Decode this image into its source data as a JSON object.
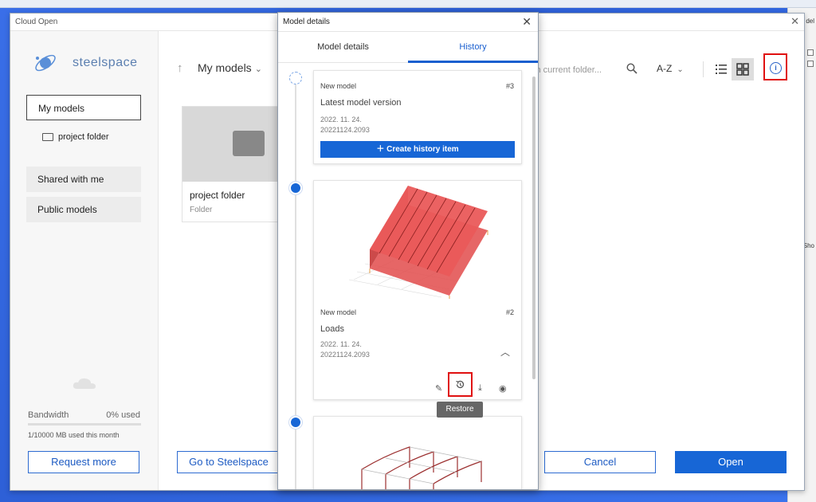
{
  "main_window": {
    "title": "Cloud Open",
    "brand": "steelspace",
    "sidebar": {
      "items": [
        {
          "label": "My models"
        },
        {
          "label": "project folder"
        },
        {
          "label": "Shared with me"
        },
        {
          "label": "Public models"
        }
      ],
      "bandwidth_label": "Bandwidth",
      "bandwidth_used": "0% used",
      "bandwidth_month": "1/10000 MB used this month",
      "request_more": "Request more"
    },
    "toolbar": {
      "breadcrumb": "My models",
      "search_placeholder": "in current folder...",
      "sort_label": "A-Z"
    },
    "folder_card": {
      "name": "project folder",
      "type": "Folder"
    },
    "buttons": {
      "goto": "Go to Steelspace",
      "cancel": "Cancel",
      "open": "Open"
    },
    "colors": {
      "accent": "#1766d6",
      "highlight_box": "#e01010"
    }
  },
  "model_details": {
    "window_title": "Model details",
    "tabs": [
      {
        "label": "Model details",
        "active": false
      },
      {
        "label": "History",
        "active": true
      }
    ],
    "history": [
      {
        "kind": "New model",
        "number": "#3",
        "name": "Latest model version",
        "date": "2022. 11. 24.",
        "version": "20221124.2093",
        "action": "Create history item"
      },
      {
        "kind": "New model",
        "number": "#2",
        "name": "Loads",
        "date": "2022. 11. 24.",
        "version": "20221124.2093"
      }
    ],
    "tooltip": "Restore"
  }
}
